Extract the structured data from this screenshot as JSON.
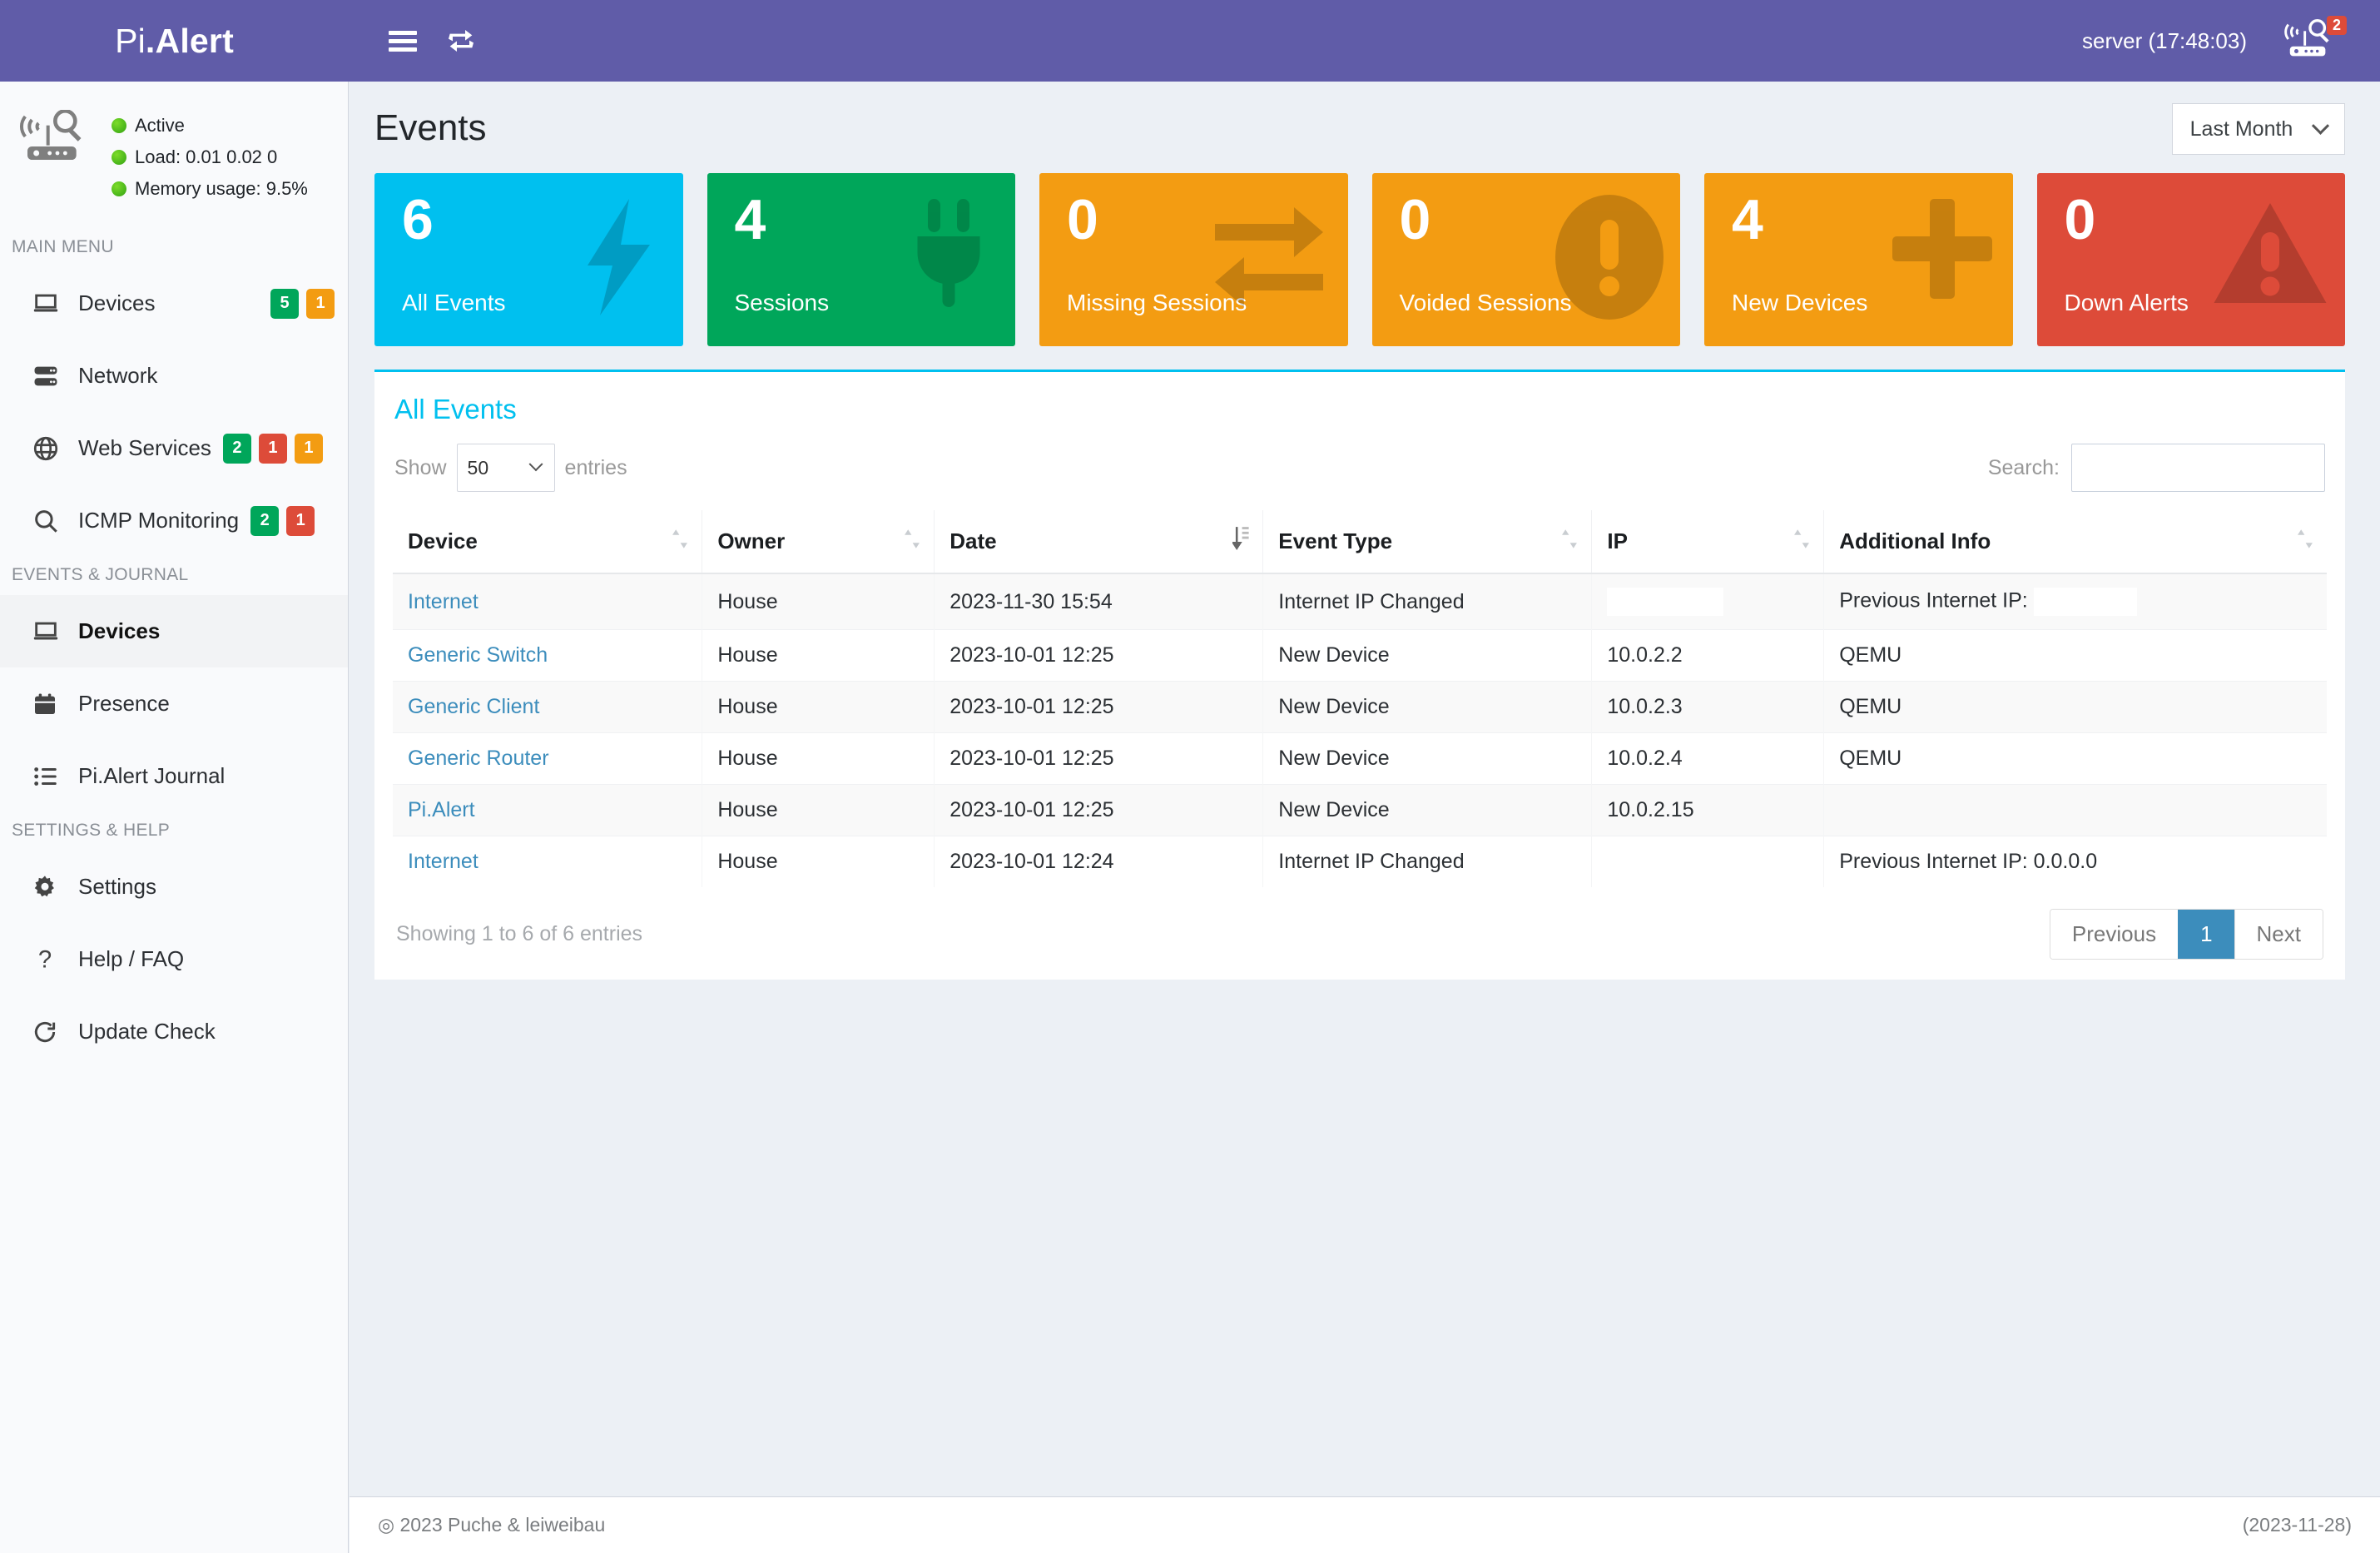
{
  "navbar": {
    "brand_prefix": "Pi",
    "brand_suffix": ".Alert",
    "menu_icon": "hamburger-icon",
    "refresh_icon": "refresh-icon",
    "server_clock": "server (17:48:03)",
    "device_alert_icon": "router-scan-icon",
    "device_alert_count": "2"
  },
  "sidebar": {
    "status": {
      "icon": "router-scan-icon",
      "active": "Active",
      "load": "Load:  0.01  0.02  0",
      "memory": "Memory usage:  9.5%"
    },
    "sections": [
      {
        "heading": "MAIN MENU",
        "items": [
          {
            "label": "Devices",
            "icon": "laptop-icon",
            "active": false,
            "badges": [
              {
                "text": "5",
                "color": "#00a65a"
              },
              {
                "text": "1",
                "color": "#f39c12"
              }
            ],
            "badges_right": true
          },
          {
            "label": "Network",
            "icon": "server-stack-icon",
            "active": false,
            "badges": [],
            "badges_right": false
          },
          {
            "label": "Web Services",
            "icon": "globe-icon",
            "active": false,
            "badges": [
              {
                "text": "2",
                "color": "#00a65a"
              },
              {
                "text": "1",
                "color": "#dd4b39"
              },
              {
                "text": "1",
                "color": "#f39c12"
              }
            ],
            "badges_right": false
          },
          {
            "label": "ICMP Monitoring",
            "icon": "magnifier-icon",
            "active": false,
            "badges": [
              {
                "text": "2",
                "color": "#00a65a"
              },
              {
                "text": "1",
                "color": "#dd4b39"
              }
            ],
            "badges_right": false
          }
        ]
      },
      {
        "heading": "EVENTS & JOURNAL",
        "items": [
          {
            "label": "Devices",
            "icon": "laptop-icon",
            "active": true,
            "badges": [],
            "badges_right": false
          },
          {
            "label": "Presence",
            "icon": "calendar-icon",
            "active": false,
            "badges": [],
            "badges_right": false
          },
          {
            "label": "Pi.Alert Journal",
            "icon": "list-icon",
            "active": false,
            "badges": [],
            "badges_right": false
          }
        ]
      },
      {
        "heading": "SETTINGS & HELP",
        "items": [
          {
            "label": "Settings",
            "icon": "gear-icon",
            "active": false,
            "badges": [],
            "badges_right": false
          },
          {
            "label": "Help / FAQ",
            "icon": "question-icon",
            "active": false,
            "badges": [],
            "badges_right": false
          },
          {
            "label": "Update Check",
            "icon": "refresh-icon",
            "active": false,
            "badges": [],
            "badges_right": false
          }
        ]
      }
    ]
  },
  "page": {
    "title": "Events",
    "period_selected": "Last Month",
    "period_icon": "chevron-down-icon"
  },
  "stats": [
    {
      "value": "6",
      "label": "All Events",
      "color": "#00c0ef",
      "icon": "bolt-icon"
    },
    {
      "value": "4",
      "label": "Sessions",
      "color": "#00a65a",
      "icon": "plug-icon"
    },
    {
      "value": "0",
      "label": "Missing Sessions",
      "color": "#f39c12",
      "icon": "exchange-arrows-icon"
    },
    {
      "value": "0",
      "label": "Voided Sessions",
      "color": "#f39c12",
      "icon": "exclamation-circle-icon"
    },
    {
      "value": "4",
      "label": "New Devices",
      "color": "#f39c12",
      "icon": "plus-icon"
    },
    {
      "value": "0",
      "label": "Down Alerts",
      "color": "#dd4b39",
      "icon": "warning-triangle-icon"
    }
  ],
  "table": {
    "panel_title": "All Events",
    "show_label": "Show",
    "entries_label": "entries",
    "page_length": "50",
    "search_label": "Search:",
    "search_value": "",
    "search_placeholder": "",
    "columns": [
      {
        "label": "Device",
        "sort": "none"
      },
      {
        "label": "Owner",
        "sort": "none"
      },
      {
        "label": "Date",
        "sort": "desc"
      },
      {
        "label": "Event Type",
        "sort": "none"
      },
      {
        "label": "IP",
        "sort": "none"
      },
      {
        "label": "Additional Info",
        "sort": "none"
      }
    ],
    "rows": [
      {
        "device": "Internet",
        "owner": "House",
        "date": "2023-11-30  15:54",
        "event_type": "Internet IP Changed",
        "ip": "",
        "info": "Previous Internet IP: ",
        "ip_redacted": true,
        "info_redacted": true
      },
      {
        "device": "Generic Switch",
        "owner": "House",
        "date": "2023-10-01  12:25",
        "event_type": "New Device",
        "ip": "10.0.2.2",
        "info": "QEMU",
        "ip_redacted": false,
        "info_redacted": false
      },
      {
        "device": "Generic Client",
        "owner": "House",
        "date": "2023-10-01  12:25",
        "event_type": "New Device",
        "ip": "10.0.2.3",
        "info": "QEMU",
        "ip_redacted": false,
        "info_redacted": false
      },
      {
        "device": "Generic Router",
        "owner": "House",
        "date": "2023-10-01  12:25",
        "event_type": "New Device",
        "ip": "10.0.2.4",
        "info": "QEMU",
        "ip_redacted": false,
        "info_redacted": false
      },
      {
        "device": "Pi.Alert",
        "owner": "House",
        "date": "2023-10-01  12:25",
        "event_type": "New Device",
        "ip": "10.0.2.15",
        "info": "",
        "ip_redacted": false,
        "info_redacted": false
      },
      {
        "device": "Internet",
        "owner": "House",
        "date": "2023-10-01  12:24",
        "event_type": "Internet IP Changed",
        "ip": "",
        "info": "Previous Internet IP: 0.0.0.0",
        "ip_redacted": false,
        "info_redacted": false
      }
    ],
    "info_text": "Showing 1 to 6 of 6 entries",
    "pager": {
      "previous": "Previous",
      "current": "1",
      "next": "Next"
    }
  },
  "footer": {
    "copyright": "◎ 2023 Puche & leiweibau",
    "version_date": "(2023-11-28)"
  }
}
